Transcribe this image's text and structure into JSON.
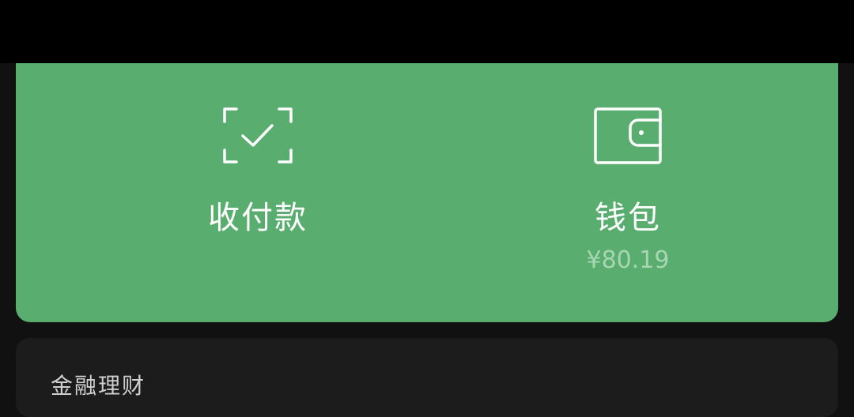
{
  "colors": {
    "card_green": "#58ad6f",
    "background": "#111111",
    "status_bar": "#000000",
    "label": "#ffffff",
    "sub_label": "#a8d6b3"
  },
  "pay_card": {
    "pay": {
      "label": "收付款",
      "icon": "scan-check-icon"
    },
    "wallet": {
      "label": "钱包",
      "balance": "¥80.19",
      "icon": "wallet-icon"
    }
  },
  "finance_section": {
    "title": "金融理财"
  }
}
